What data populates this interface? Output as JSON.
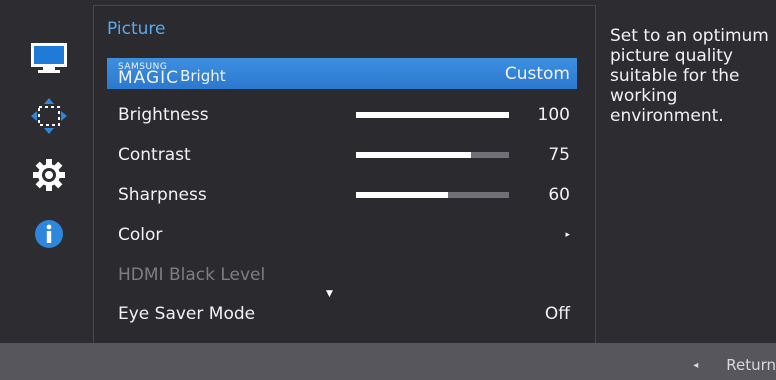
{
  "menu": {
    "title": "Picture",
    "items": [
      {
        "brand_small": "SAMSUNG",
        "brand_big": "MAGIC",
        "label": "Bright",
        "value": "Custom"
      },
      {
        "label": "Brightness",
        "value": "100",
        "level": 1.0
      },
      {
        "label": "Contrast",
        "value": "75",
        "level": 0.75
      },
      {
        "label": "Sharpness",
        "value": "60",
        "level": 0.6
      },
      {
        "label": "Color",
        "value": "▸"
      },
      {
        "label": "HDMI Black Level",
        "value": ""
      },
      {
        "label": "Eye Saver Mode",
        "value": "Off"
      }
    ],
    "scroll_indicator": "▼"
  },
  "help": {
    "text": "Set to an optimum picture quality suitable for the working environment."
  },
  "footer": {
    "return_arrow": "◂",
    "return_label": "Return"
  },
  "sidebar": {
    "icons": [
      "monitor-icon",
      "move-arrows-icon",
      "gear-icon",
      "info-icon"
    ]
  },
  "colors": {
    "accent": "#3d8fe0",
    "title": "#5aa9ec",
    "background": "#2d2d31",
    "disabled_text": "#7d7d83"
  }
}
